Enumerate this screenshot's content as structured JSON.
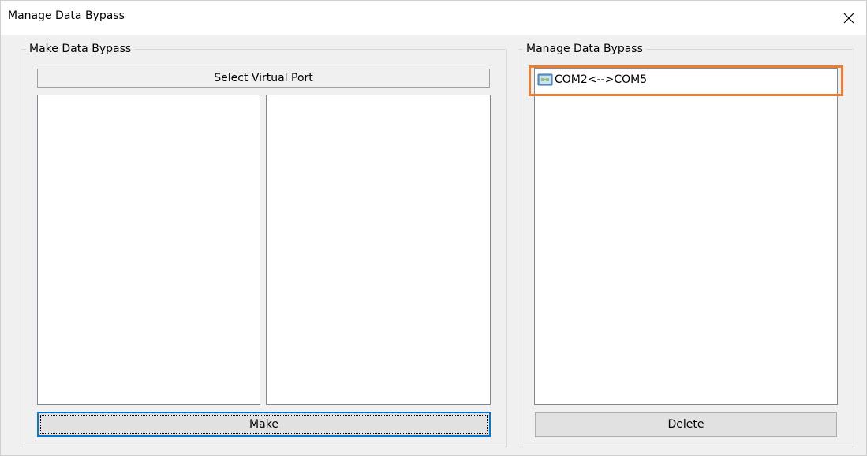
{
  "window": {
    "title": "Manage Data Bypass",
    "close_icon": "close-icon"
  },
  "make_group": {
    "label": "Make Data Bypass",
    "header": "Select Virtual Port",
    "make_button": "Make"
  },
  "manage_group": {
    "label": "Manage Data Bypass",
    "items": [
      {
        "label": "COM2<-->COM5",
        "icon": "port-link-icon"
      }
    ],
    "delete_button": "Delete"
  },
  "colors": {
    "highlight": "#ed7d31",
    "focus": "#0078d7"
  }
}
